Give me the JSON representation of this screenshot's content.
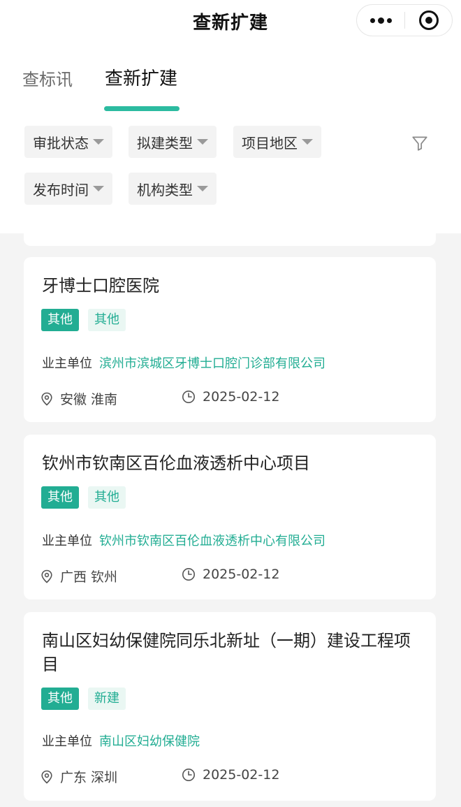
{
  "nav": {
    "title": "查新扩建"
  },
  "tabs": [
    {
      "label": "查标讯"
    },
    {
      "label": "查新扩建"
    }
  ],
  "filters": [
    {
      "label": "审批状态"
    },
    {
      "label": "拟建类型"
    },
    {
      "label": "项目地区"
    },
    {
      "label": "发布时间"
    },
    {
      "label": "机构类型"
    }
  ],
  "owner_label": "业主单位",
  "cards": [
    {
      "title": "牙博士口腔医院",
      "tag1": "其他",
      "tag2": "其他",
      "owner": "滨州市滨城区牙博士口腔门诊部有限公司",
      "location": "安徽 淮南",
      "date": "2025-02-12"
    },
    {
      "title": "钦州市钦南区百伦血液透析中心项目",
      "tag1": "其他",
      "tag2": "其他",
      "owner": "钦州市钦南区百伦血液透析中心有限公司",
      "location": "广西 钦州",
      "date": "2025-02-12"
    },
    {
      "title": "南山区妇幼保健院同乐北新址（一期）建设工程项目",
      "tag1": "其他",
      "tag2": "新建",
      "owner": "南山区妇幼保健院",
      "location": "广东 深圳",
      "date": "2025-02-12"
    }
  ],
  "colors": {
    "accent": "#22ad93",
    "tab_underline": "#2cbba0"
  }
}
